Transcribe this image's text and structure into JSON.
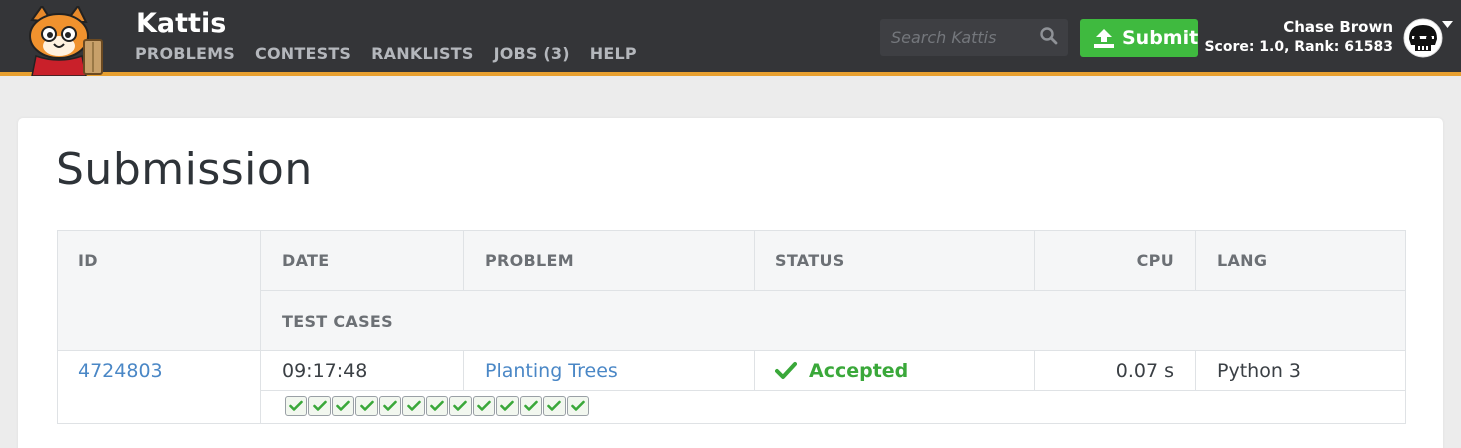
{
  "nav": {
    "brand": "Kattis",
    "links": [
      "PROBLEMS",
      "CONTESTS",
      "RANKLISTS",
      "JOBS (3)",
      "HELP"
    ],
    "search_placeholder": "Search Kattis",
    "submit_label": "Submit",
    "user_name": "Chase Brown",
    "user_score": "Score: 1.0, Rank: 61583"
  },
  "page": {
    "title": "Submission"
  },
  "table": {
    "headers": {
      "id": "ID",
      "date": "DATE",
      "problem": "PROBLEM",
      "status": "STATUS",
      "cpu": "CPU",
      "lang": "LANG",
      "test_cases": "TEST CASES"
    },
    "row": {
      "id": "4724803",
      "date": "09:17:48",
      "problem": "Planting Trees",
      "status": "Accepted",
      "cpu": "0.07 s",
      "lang": "Python 3",
      "test_cases_passed": 13,
      "test_cases_total": 13
    }
  },
  "colors": {
    "navbar": "#343538",
    "accent_bar": "#e8a030",
    "submit_green": "#3fba3f",
    "link_blue": "#4a87c6",
    "accepted_green": "#3aa83a"
  },
  "icons": [
    "kattis-cat-logo",
    "search-icon",
    "upload-icon",
    "skull-avatar-icon",
    "caret-down-icon",
    "check-icon"
  ]
}
